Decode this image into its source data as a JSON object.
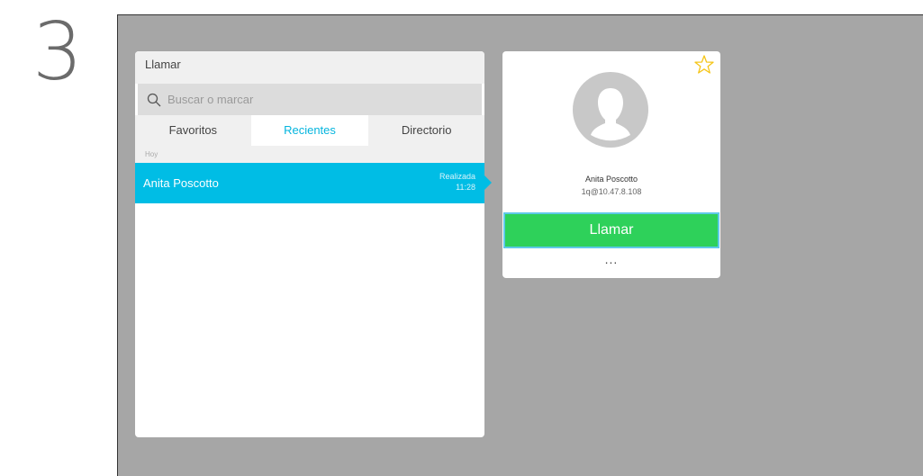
{
  "step": {
    "number": "3"
  },
  "call_panel": {
    "title": "Llamar",
    "search": {
      "placeholder": "Buscar o marcar",
      "value": ""
    },
    "tabs": [
      {
        "label": "Favoritos",
        "active": false
      },
      {
        "label": "Recientes",
        "active": true
      },
      {
        "label": "Directorio",
        "active": false
      }
    ],
    "section_label": "Hoy",
    "recent_items": [
      {
        "name": "Anita Poscotto",
        "status": "Realizada",
        "time": "11:28",
        "selected": true
      }
    ]
  },
  "contact_card": {
    "name": "Anita Poscotto",
    "address": "1q@10.47.8.108",
    "call_label": "Llamar",
    "more_label": "...",
    "favorite_icon": "star-outline-icon",
    "avatar_icon": "person-silhouette-icon"
  },
  "colors": {
    "screen_bg": "#a6a6a6",
    "accent": "#00bde5",
    "call_green": "#2ed15a",
    "star_yellow": "#f5c518"
  }
}
